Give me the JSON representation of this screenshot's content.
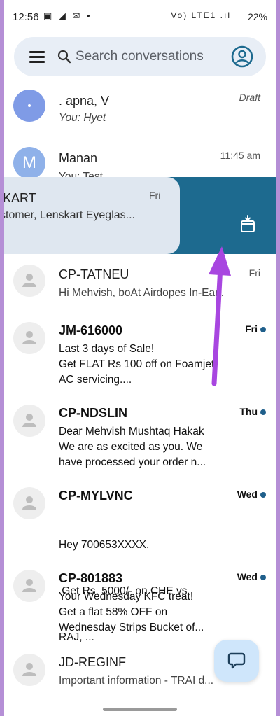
{
  "status_bar": {
    "time": "12:56",
    "left_icons": "▣ ◢ ✉ •",
    "system": "Vo) LTE1 .ıl",
    "battery": "22%"
  },
  "search": {
    "placeholder": "Search conversations"
  },
  "conversations": [
    {
      "name": ". apna, V",
      "snippet": "You: Hyet",
      "time": "Draft"
    },
    {
      "name": "Manan",
      "initial": "M",
      "snippet": "You: Test",
      "time": "11:45 am"
    },
    {
      "name": "CP-TATNEU",
      "snippet": "Hi Mehvish, boAt Airdopes In-Ear...",
      "time": "Fri"
    },
    {
      "name": "JM-616000",
      "snippet_lines": [
        "Last 3 days of Sale!",
        "Get FLAT Rs 100 off on Foamjet",
        "AC servicing...."
      ],
      "time": "Fri"
    },
    {
      "name": "CP-NDSLIN",
      "snippet_lines": [
        "Dear Mehvish Mushtaq Hakak",
        "We are as excited as you. We",
        "have processed your order n..."
      ],
      "time": "Thu"
    },
    {
      "name": "CP-MYLVNC",
      "snippet_lines": [
        "Hey 700653XXXX,",
        " Get Rs. 5000/- on CHE vs",
        "RAJ, ..."
      ],
      "time": "Wed"
    },
    {
      "name": "CP-801883",
      "snippet_lines": [
        "Your Wednesday KFC treat!",
        "Get a flat 58% OFF on",
        "Wednesday Strips Bucket of..."
      ],
      "time": "Wed"
    },
    {
      "name": "JD-REGINF",
      "snippet": "Important information - TRAI d..."
    }
  ],
  "swiped_item": {
    "name": "KART",
    "snippet": "stomer, Lenskart Eyeglas...",
    "time": "Fri",
    "action_icon": "archive-icon"
  },
  "colors": {
    "swipe_action_bg": "#1d6a8f",
    "accent": "#1f5f8b",
    "annotation_arrow": "#a846e0",
    "fab_bg": "#cfe6fb"
  },
  "fab": {
    "icon": "chat-icon"
  }
}
